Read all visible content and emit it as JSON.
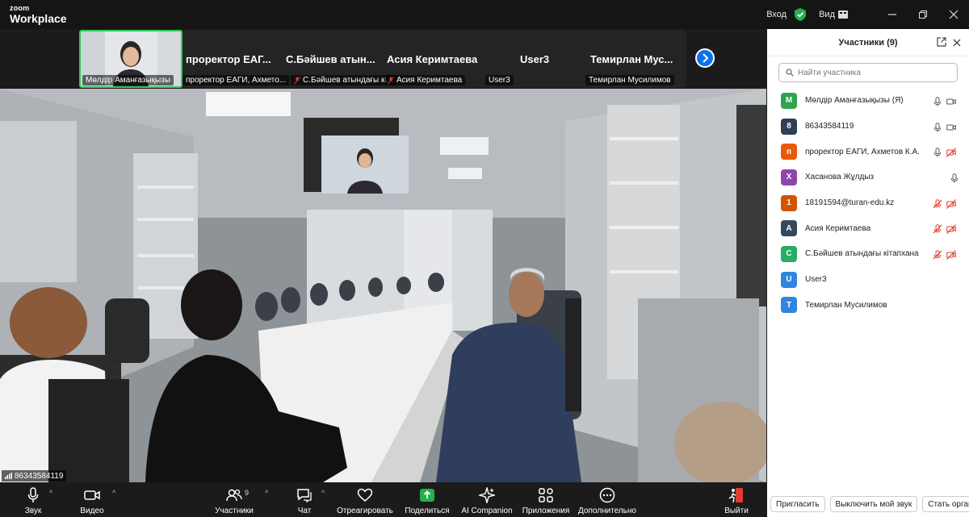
{
  "app": {
    "brand_small": "zoom",
    "brand_large": "Workplace"
  },
  "titlebar": {
    "login_label": "Вход",
    "view_label": "Вид"
  },
  "strip": {
    "self_name": "Мөлдір Аманғазықызы",
    "tiles": [
      {
        "name": "проректор ЕАГ...",
        "label": "проректор ЕАГИ, Ахмето...",
        "muted": false
      },
      {
        "name": "С.Бәйшев атын...",
        "label": "С.Бәйшев атындағы кі...",
        "muted": true
      },
      {
        "name": "Асия Керимтаева",
        "label": "Асия Керимтаева",
        "muted": true
      },
      {
        "name": "User3",
        "label": "User3",
        "muted": false
      },
      {
        "name": "Темирлан Мус...",
        "label": "Темирлан Мусилимов",
        "muted": false
      }
    ]
  },
  "video": {
    "speaker_label": "86343584119"
  },
  "toolbar": {
    "audio": "Звук",
    "video": "Видео",
    "participants": "Участники",
    "participants_count": "9",
    "chat": "Чат",
    "react": "Отреагировать",
    "share": "Поделиться",
    "ai": "AI Companion",
    "apps": "Приложения",
    "more": "Дополнительно",
    "leave": "Выйти"
  },
  "panel": {
    "title": "Участники (9)",
    "search_placeholder": "Найти участника",
    "participants": [
      {
        "initial": "М",
        "color": "#2da44e",
        "name": "Мөлдір Аманғазықызы (Я)",
        "mic": "on",
        "cam": "on"
      },
      {
        "initial": "8",
        "color": "#2f3e57",
        "name": "86343584119",
        "mic": "on",
        "cam": "on"
      },
      {
        "initial": "п",
        "color": "#e8590c",
        "name": "проректор ЕАГИ, Ахметов К.А.",
        "mic": "on",
        "cam": "off"
      },
      {
        "initial": "Х",
        "color": "#8e44ad",
        "name": "Хасанова Жұлдыз",
        "mic": "on",
        "cam": "none"
      },
      {
        "initial": "1",
        "color": "#d35400",
        "name": "18191594@turan-edu.kz",
        "mic": "off",
        "cam": "off"
      },
      {
        "initial": "А",
        "color": "#34495e",
        "name": "Асия Керимтаева",
        "mic": "off",
        "cam": "off"
      },
      {
        "initial": "С",
        "color": "#27ae60",
        "name": "С.Бәйшев атындағы кітапхана",
        "mic": "off",
        "cam": "off"
      },
      {
        "initial": "U",
        "color": "#2e86de",
        "name": "User3",
        "mic": "none",
        "cam": "none"
      },
      {
        "initial": "Т",
        "color": "#2e86de",
        "name": "Темирлан Мусилимов",
        "mic": "none",
        "cam": "none"
      }
    ],
    "buttons": {
      "invite": "Пригласить",
      "mute_me": "Выключить мой звук",
      "become_host": "Стать организ"
    }
  }
}
